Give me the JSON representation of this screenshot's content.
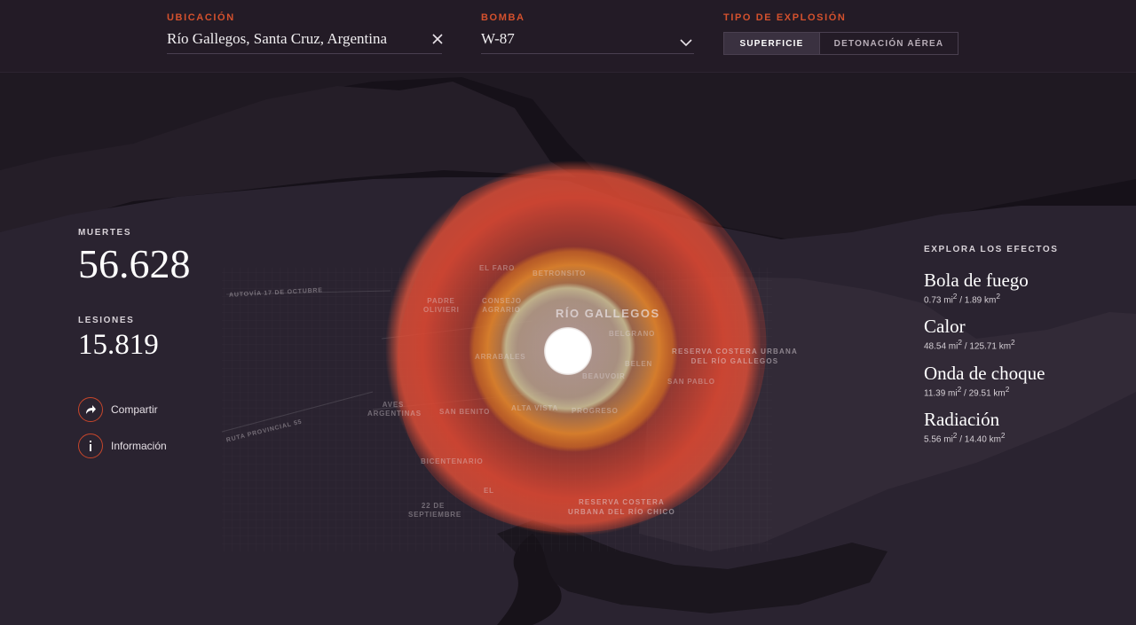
{
  "header": {
    "location": {
      "label": "UBICACIÓN",
      "value": "Río Gallegos, Santa Cruz, Argentina",
      "clear_icon": "close-icon"
    },
    "bomb": {
      "label": "BOMBA",
      "value": "W-87",
      "dropdown_icon": "chevron-down-icon"
    },
    "explosion_type": {
      "label": "TIPO DE EXPLOSIÓN",
      "options": [
        "SUPERFICIE",
        "DETONACIÓN AÉREA"
      ],
      "selected": "SUPERFICIE"
    }
  },
  "stats": {
    "deaths_label": "MUERTES",
    "deaths_value": "56.628",
    "injuries_label": "LESIONES",
    "injuries_value": "15.819"
  },
  "actions": {
    "share_label": "Compartir",
    "info_label": "Información",
    "share_icon": "share-arrow-icon",
    "info_icon": "info-icon"
  },
  "effects": {
    "title": "EXPLORA LOS EFECTOS",
    "items": [
      {
        "name": "Bola de fuego",
        "mi": "0.73 mi",
        "km": " / 1.89 km",
        "sup": "2"
      },
      {
        "name": "Calor",
        "mi": "48.54 mi",
        "km": " / 125.71 km",
        "sup": "2"
      },
      {
        "name": "Onda de choque",
        "mi": "11.39 mi",
        "km": " / 29.51 km",
        "sup": "2"
      },
      {
        "name": "Radiación",
        "mi": "5.56 mi",
        "km": " / 14.40 km",
        "sup": "2"
      }
    ]
  },
  "map": {
    "city": "RÍO GALLEGOS",
    "neighborhoods": [
      "EL FARO",
      "BETRONSITO",
      "PADRE OLIVIERI",
      "CONSEJO AGRARIO",
      "BELGRANO",
      "ARRABALES",
      "BELEN",
      "BEAUVOIR",
      "SAN PABLO",
      "ALTA VISTA",
      "PROGRESO",
      "SAN BENITO",
      "AVES ARGENTINAS",
      "BICENTENARIO",
      "22 DE SEPTIEMBRE",
      "EL"
    ],
    "roads": [
      "AUTOVÍA 17 DE OCTUBRE",
      "RUTA PROVINCIAL 55"
    ],
    "reserves": [
      {
        "line1": "RESERVA COSTERA URBANA",
        "line2": "DEL RÍO GALLEGOS"
      },
      {
        "line1": "RESERVA COSTERA",
        "line2": "URBANA DEL RÍO CHICO"
      }
    ],
    "colors": {
      "heat": "#e04632",
      "shock": "#d87a2a",
      "fireball": "#ffffff",
      "land": "#2c2530",
      "water": "#141017"
    }
  }
}
